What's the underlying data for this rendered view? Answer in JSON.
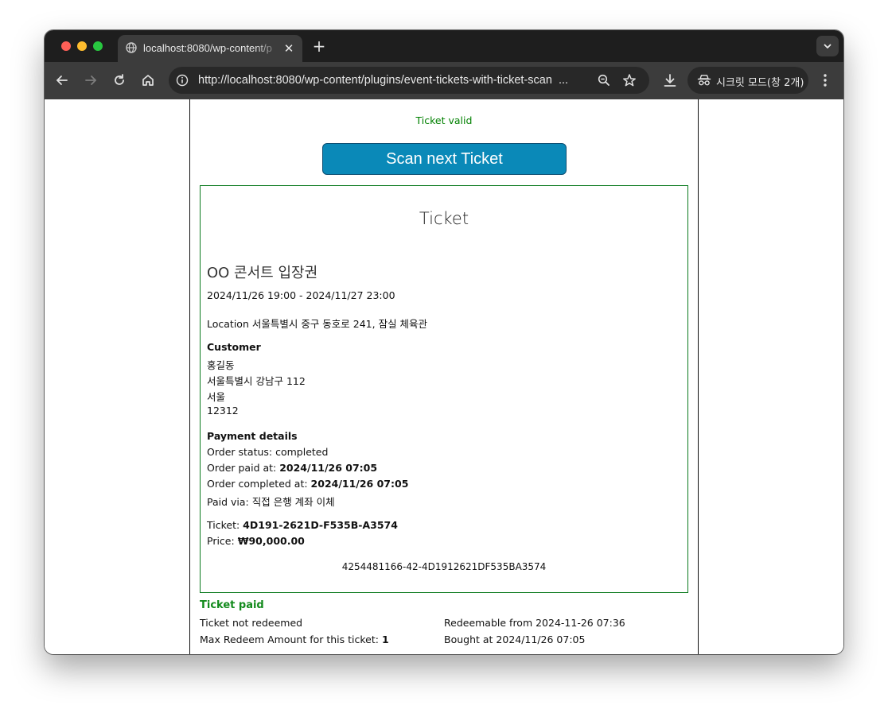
{
  "browser": {
    "tab": {
      "title": "localhost:8080/wp-content/p"
    },
    "close_glyph": "✕",
    "newtab_glyph": "+",
    "url_text": "http://localhost:8080/wp-content/plugins/event-tickets-with-ticket-scan",
    "url_ellipsis": "...",
    "incognito_label": "시크릿 모드(창 2개)",
    "icons": [
      "globe-icon",
      "close-icon",
      "plus-icon",
      "chevron-down-icon",
      "back-arrow-icon",
      "forward-arrow-icon",
      "reload-icon",
      "home-icon",
      "info-icon",
      "zoom-icon",
      "star-icon",
      "download-icon",
      "incognito-icon",
      "more-vert-icon"
    ],
    "colors": {
      "frame": "#1e1e1e",
      "toolbar": "#3c3c3c",
      "omnibox": "#282828"
    }
  },
  "page": {
    "status_message": "Ticket valid",
    "scan_button": "Scan next Ticket",
    "ticket": {
      "heading": "Ticket",
      "event_name": "OO 콘서트 입장권",
      "datetime": "2024/11/26 19:00 - 2024/11/27 23:00",
      "location": "Location 서울특별시 중구 동호로 241, 잠실 체육관",
      "customer_label": "Customer",
      "customer_name": "홍길동",
      "customer_address": "서울특별시 강남구 112",
      "customer_city": "서울",
      "customer_zip": "12312",
      "payment_label": "Payment details",
      "order_status": "Order status: completed",
      "order_paid_label": "Order paid at: ",
      "order_paid_value": "2024/11/26 07:05",
      "order_completed_label": "Order completed at: ",
      "order_completed_value": "2024/11/26 07:05",
      "paid_via": "Paid via: 직접 은행 계좌 이체",
      "ticket_label": "Ticket: ",
      "ticket_value": "4D191-2621D-F535B-A3574",
      "price_label": "Price: ",
      "price_value": "₩90,000.00",
      "code": "4254481166-42-4D1912621DF535BA3574"
    },
    "paid_status": "Ticket paid",
    "redeem_status": "Ticket not redeemed",
    "max_redeem_label": "Max Redeem Amount for this ticket: ",
    "max_redeem_value": "1",
    "redeemable_from": "Redeemable from 2024-11-26 07:36",
    "bought_at": "Bought at 2024/11/26 07:05",
    "colors": {
      "valid": "#008000",
      "button": "#0a89b8",
      "box_border": "#0b7a1e"
    }
  }
}
